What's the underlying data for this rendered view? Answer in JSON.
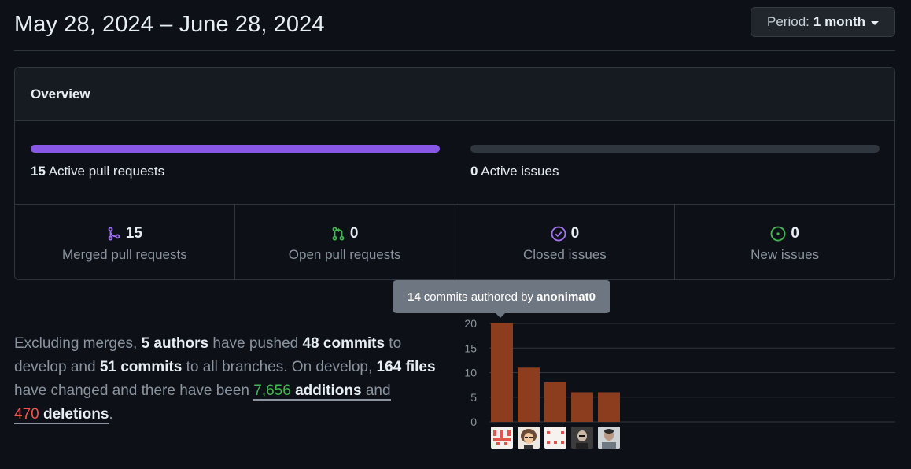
{
  "header": {
    "date_range": "May 28, 2024 – June 28, 2024",
    "period_label": "Period:",
    "period_value": "1 month"
  },
  "overview": {
    "title": "Overview",
    "pull_requests": {
      "count": "15",
      "label": "Active pull requests",
      "fill_fraction": 1.0,
      "color": "#8957e5"
    },
    "issues": {
      "count": "0",
      "label": "Active issues",
      "fill_fraction": 0
    },
    "stats": [
      {
        "icon": "merged-pr-icon",
        "count": "15",
        "label": "Merged pull requests",
        "color": "#a371f7"
      },
      {
        "icon": "open-pr-icon",
        "count": "0",
        "label": "Open pull requests",
        "color": "#3fb950"
      },
      {
        "icon": "closed-issue-icon",
        "count": "0",
        "label": "Closed issues",
        "color": "#a371f7"
      },
      {
        "icon": "new-issue-icon",
        "count": "0",
        "label": "New issues",
        "color": "#3fb950"
      }
    ]
  },
  "summary": {
    "p1": "Excluding merges, ",
    "authors": "5 authors",
    "p2": " have pushed ",
    "commits_develop": "48 commits",
    "p3": " to develop and ",
    "commits_all": "51 commits",
    "p4": " to all branches. On develop, ",
    "files": "164 files",
    "p5": " have changed and there have been ",
    "additions_num": "7,656",
    "additions_word": " additions",
    "p6": " and",
    "deletions_num": "470",
    "deletions_word": " deletions",
    "p7": "."
  },
  "tooltip": {
    "count": "14",
    "text": "commits authored by",
    "author": "anonimat0"
  },
  "chart_data": {
    "type": "bar",
    "categories": [
      "author-1",
      "author-2",
      "author-3",
      "author-4",
      "author-5"
    ],
    "values": [
      20,
      11,
      8,
      6,
      6
    ],
    "ylim": [
      0,
      20
    ],
    "yticks": [
      "0",
      "5",
      "10",
      "15",
      "20"
    ],
    "grid": true,
    "bar_color": "#8b3d1e",
    "x_labels": "avatars"
  }
}
